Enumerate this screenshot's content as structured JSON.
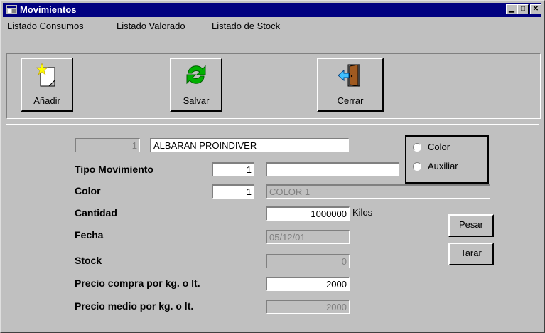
{
  "window": {
    "title": "Movimientos"
  },
  "menu": [
    "Listado Consumos",
    "Listado Valorado",
    "Listado de Stock"
  ],
  "toolbar": {
    "add_label": "Añadir",
    "save_label": "Salvar",
    "close_label": "Cerrar"
  },
  "form": {
    "code": "1",
    "description": "ALBARAN PROINDIVER",
    "tipo_label": "Tipo Movimiento",
    "tipo_code": "1",
    "tipo_desc": "",
    "color_label": "Color",
    "color_code": "1",
    "color_desc": "COLOR 1",
    "cantidad_label": "Cantidad",
    "cantidad_value": "1000000",
    "cantidad_unit": "Kilos",
    "fecha_label": "Fecha",
    "fecha_value": "05/12/01",
    "stock_label": "Stock",
    "stock_value": "0",
    "precio_compra_label": "Precio compra por kg. o lt.",
    "precio_compra_value": "2000",
    "precio_medio_label": "Precio medio por kg. o lt.",
    "precio_medio_value": "2000"
  },
  "radio": {
    "option1": "Color",
    "option2": "Auxiliar"
  },
  "buttons": {
    "pesar": "Pesar",
    "tarar": "Tarar"
  }
}
